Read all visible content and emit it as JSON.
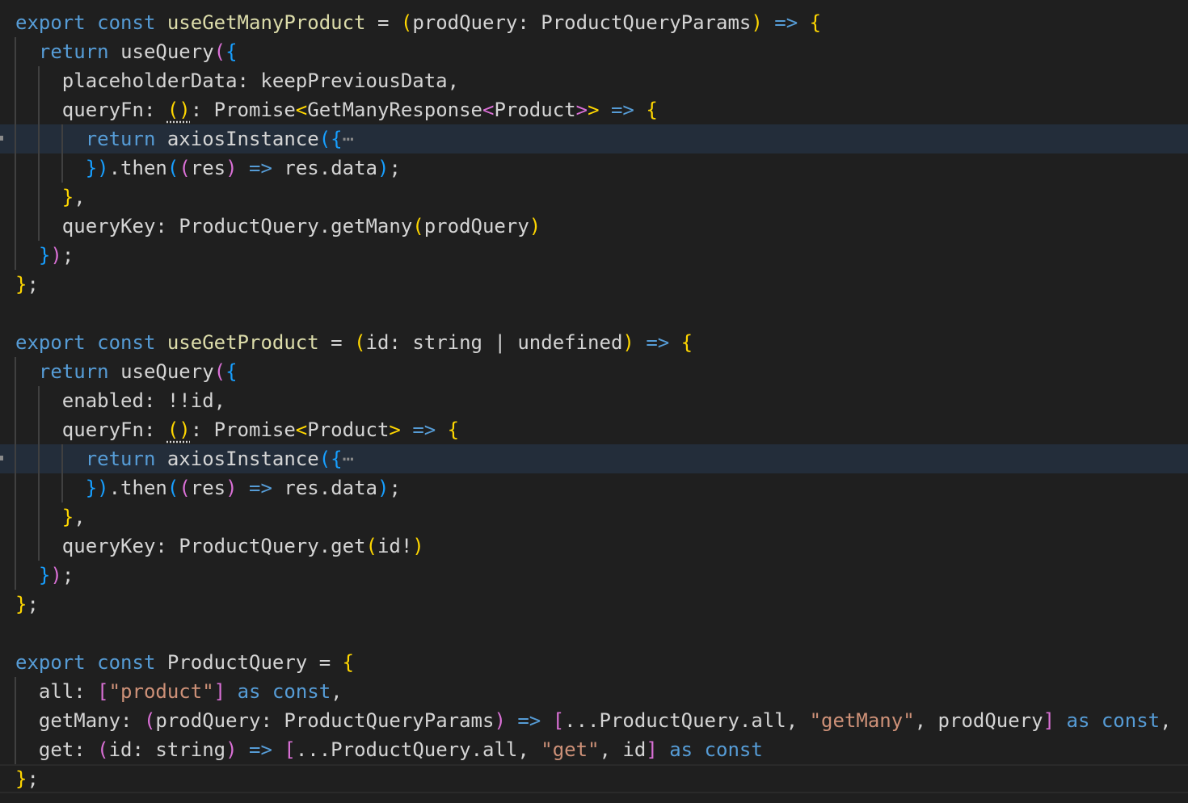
{
  "editor": {
    "language": "typescript",
    "colors": {
      "background": "#1f1f1f",
      "collapsed_highlight": "#232d3a",
      "keyword": "#569cd6",
      "bracket_level_1": "#ffd700",
      "bracket_level_2": "#da70d6",
      "bracket_level_3": "#179fff",
      "string": "#ce9178"
    },
    "lines": [
      "export const useGetManyProduct = (prodQuery: ProductQueryParams) => {",
      "  return useQuery({",
      "    placeholderData: keepPreviousData,",
      "    queryFn: (): Promise<GetManyResponse<Product>> => {",
      "      return axiosInstance({⋯",
      "      }).then((res) => res.data);",
      "    },",
      "    queryKey: ProductQuery.getMany(prodQuery)",
      "  });",
      "};",
      "",
      "export const useGetProduct = (id: string | undefined) => {",
      "  return useQuery({",
      "    enabled: !!id,",
      "    queryFn: (): Promise<Product> => {",
      "      return axiosInstance({⋯",
      "      }).then((res) => res.data);",
      "    },",
      "    queryKey: ProductQuery.get(id!)",
      "  });",
      "};",
      "",
      "export const ProductQuery = {",
      "  all: [\"product\"] as const,",
      "  getMany: (prodQuery: ProductQueryParams) => [...ProductQuery.all, \"getMany\", prodQuery] as const,",
      "  get: (id: string) => [...ProductQuery.all, \"get\", id] as const",
      "};"
    ],
    "tokens": {
      "export": "export",
      "const": "const",
      "return": "return",
      "as": "as",
      "arrow": "=>",
      "fold_ellipsis": "⋯"
    }
  }
}
